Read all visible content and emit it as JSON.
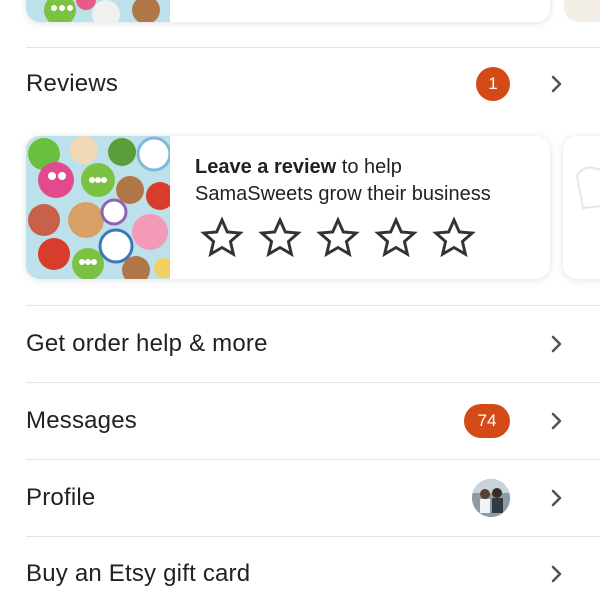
{
  "reviews": {
    "title": "Reviews",
    "badge_count": "1"
  },
  "review_card": {
    "prompt_bold": "Leave a review",
    "prompt_rest": " to help",
    "prompt_line2": "SamaSweets grow their business",
    "star_count": 5,
    "rating": 0
  },
  "menu": {
    "order_help": "Get order help & more",
    "messages": "Messages",
    "messages_badge": "74",
    "profile": "Profile",
    "gift_card": "Buy an Etsy gift card"
  },
  "colors": {
    "badge": "#d44a16",
    "divider": "#e4e4e4",
    "text": "#222222"
  },
  "icons": {
    "chevron": "chevron-right-icon",
    "star": "star-outline-icon"
  }
}
